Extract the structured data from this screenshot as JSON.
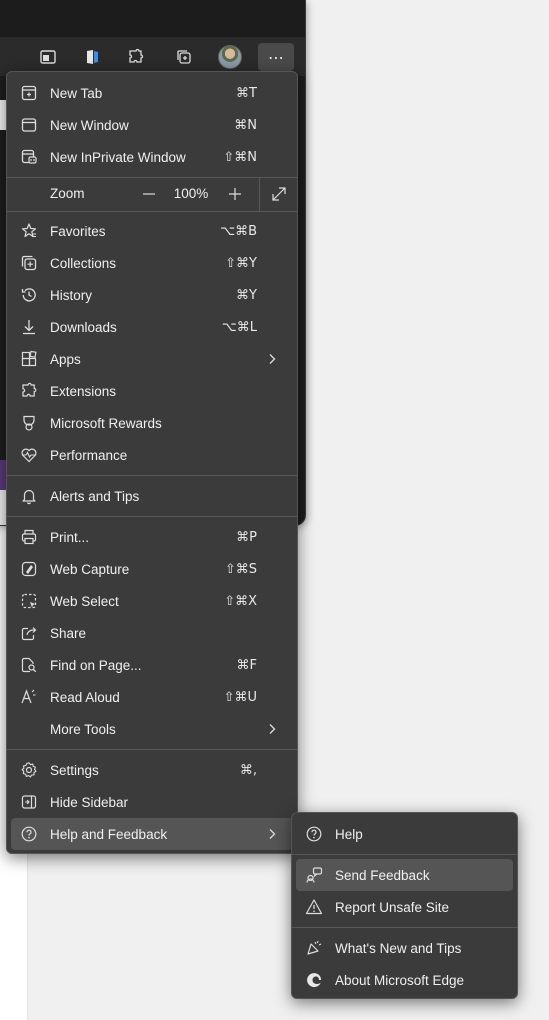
{
  "menu": {
    "group1": [
      {
        "label": "New Tab",
        "shortcut": "⌘T",
        "icon": "new-tab-icon"
      },
      {
        "label": "New Window",
        "shortcut": "⌘N",
        "icon": "new-window-icon"
      },
      {
        "label": "New InPrivate Window",
        "shortcut": "⇧⌘N",
        "icon": "inprivate-icon"
      }
    ],
    "zoom": {
      "label": "Zoom",
      "value": "100%",
      "minus": "—",
      "plus": "+"
    },
    "group2": [
      {
        "label": "Favorites",
        "shortcut": "⌥⌘B",
        "icon": "star-icon"
      },
      {
        "label": "Collections",
        "shortcut": "⇧⌘Y",
        "icon": "collections-icon"
      },
      {
        "label": "History",
        "shortcut": "⌘Y",
        "icon": "history-icon"
      },
      {
        "label": "Downloads",
        "shortcut": "⌥⌘L",
        "icon": "download-icon"
      },
      {
        "label": "Apps",
        "shortcut": "",
        "icon": "apps-icon",
        "submenu": true
      },
      {
        "label": "Extensions",
        "shortcut": "",
        "icon": "puzzle-icon"
      },
      {
        "label": "Microsoft Rewards",
        "shortcut": "",
        "icon": "trophy-icon"
      },
      {
        "label": "Performance",
        "shortcut": "",
        "icon": "heartbeat-icon"
      }
    ],
    "group3": [
      {
        "label": "Alerts and Tips",
        "shortcut": "",
        "icon": "bell-icon"
      }
    ],
    "group4": [
      {
        "label": "Print...",
        "shortcut": "⌘P",
        "icon": "printer-icon"
      },
      {
        "label": "Web Capture",
        "shortcut": "⇧⌘S",
        "icon": "web-capture-icon"
      },
      {
        "label": "Web Select",
        "shortcut": "⇧⌘X",
        "icon": "web-select-icon"
      },
      {
        "label": "Share",
        "shortcut": "",
        "icon": "share-icon"
      },
      {
        "label": "Find on Page...",
        "shortcut": "⌘F",
        "icon": "find-icon"
      },
      {
        "label": "Read Aloud",
        "shortcut": "⇧⌘U",
        "icon": "read-aloud-icon"
      },
      {
        "label": "More Tools",
        "shortcut": "",
        "icon": "",
        "submenu": true
      }
    ],
    "group5": [
      {
        "label": "Settings",
        "shortcut": "⌘,",
        "icon": "gear-icon"
      },
      {
        "label": "Hide Sidebar",
        "shortcut": "",
        "icon": "sidebar-icon"
      },
      {
        "label": "Help and Feedback",
        "shortcut": "",
        "icon": "help-icon",
        "submenu": true,
        "highlighted": true
      }
    ]
  },
  "submenu": {
    "items": [
      {
        "label": "Help",
        "icon": "help-icon"
      },
      {
        "label": "Send Feedback",
        "icon": "feedback-icon",
        "highlighted": true
      },
      {
        "label": "Report Unsafe Site",
        "icon": "warning-icon"
      },
      {
        "label": "What's New and Tips",
        "icon": "whats-new-icon"
      },
      {
        "label": "About Microsoft Edge",
        "icon": "edge-logo-icon"
      }
    ]
  },
  "toolbar": {
    "more_label": "⋯"
  },
  "colors": {
    "menu_bg": "#3b3b3b",
    "highlight": "#555555",
    "separator": "#585858",
    "text": "#f0f0f0"
  }
}
